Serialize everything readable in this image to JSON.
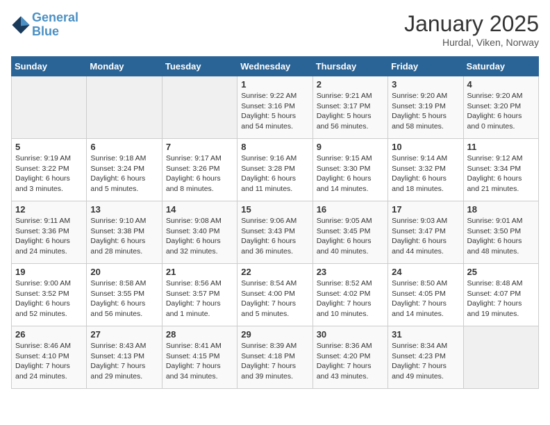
{
  "header": {
    "logo_line1": "General",
    "logo_line2": "Blue",
    "month_title": "January 2025",
    "location": "Hurdal, Viken, Norway"
  },
  "days_of_week": [
    "Sunday",
    "Monday",
    "Tuesday",
    "Wednesday",
    "Thursday",
    "Friday",
    "Saturday"
  ],
  "weeks": [
    [
      {
        "num": "",
        "info": ""
      },
      {
        "num": "",
        "info": ""
      },
      {
        "num": "",
        "info": ""
      },
      {
        "num": "1",
        "info": "Sunrise: 9:22 AM\nSunset: 3:16 PM\nDaylight: 5 hours\nand 54 minutes."
      },
      {
        "num": "2",
        "info": "Sunrise: 9:21 AM\nSunset: 3:17 PM\nDaylight: 5 hours\nand 56 minutes."
      },
      {
        "num": "3",
        "info": "Sunrise: 9:20 AM\nSunset: 3:19 PM\nDaylight: 5 hours\nand 58 minutes."
      },
      {
        "num": "4",
        "info": "Sunrise: 9:20 AM\nSunset: 3:20 PM\nDaylight: 6 hours\nand 0 minutes."
      }
    ],
    [
      {
        "num": "5",
        "info": "Sunrise: 9:19 AM\nSunset: 3:22 PM\nDaylight: 6 hours\nand 3 minutes."
      },
      {
        "num": "6",
        "info": "Sunrise: 9:18 AM\nSunset: 3:24 PM\nDaylight: 6 hours\nand 5 minutes."
      },
      {
        "num": "7",
        "info": "Sunrise: 9:17 AM\nSunset: 3:26 PM\nDaylight: 6 hours\nand 8 minutes."
      },
      {
        "num": "8",
        "info": "Sunrise: 9:16 AM\nSunset: 3:28 PM\nDaylight: 6 hours\nand 11 minutes."
      },
      {
        "num": "9",
        "info": "Sunrise: 9:15 AM\nSunset: 3:30 PM\nDaylight: 6 hours\nand 14 minutes."
      },
      {
        "num": "10",
        "info": "Sunrise: 9:14 AM\nSunset: 3:32 PM\nDaylight: 6 hours\nand 18 minutes."
      },
      {
        "num": "11",
        "info": "Sunrise: 9:12 AM\nSunset: 3:34 PM\nDaylight: 6 hours\nand 21 minutes."
      }
    ],
    [
      {
        "num": "12",
        "info": "Sunrise: 9:11 AM\nSunset: 3:36 PM\nDaylight: 6 hours\nand 24 minutes."
      },
      {
        "num": "13",
        "info": "Sunrise: 9:10 AM\nSunset: 3:38 PM\nDaylight: 6 hours\nand 28 minutes."
      },
      {
        "num": "14",
        "info": "Sunrise: 9:08 AM\nSunset: 3:40 PM\nDaylight: 6 hours\nand 32 minutes."
      },
      {
        "num": "15",
        "info": "Sunrise: 9:06 AM\nSunset: 3:43 PM\nDaylight: 6 hours\nand 36 minutes."
      },
      {
        "num": "16",
        "info": "Sunrise: 9:05 AM\nSunset: 3:45 PM\nDaylight: 6 hours\nand 40 minutes."
      },
      {
        "num": "17",
        "info": "Sunrise: 9:03 AM\nSunset: 3:47 PM\nDaylight: 6 hours\nand 44 minutes."
      },
      {
        "num": "18",
        "info": "Sunrise: 9:01 AM\nSunset: 3:50 PM\nDaylight: 6 hours\nand 48 minutes."
      }
    ],
    [
      {
        "num": "19",
        "info": "Sunrise: 9:00 AM\nSunset: 3:52 PM\nDaylight: 6 hours\nand 52 minutes."
      },
      {
        "num": "20",
        "info": "Sunrise: 8:58 AM\nSunset: 3:55 PM\nDaylight: 6 hours\nand 56 minutes."
      },
      {
        "num": "21",
        "info": "Sunrise: 8:56 AM\nSunset: 3:57 PM\nDaylight: 7 hours\nand 1 minute."
      },
      {
        "num": "22",
        "info": "Sunrise: 8:54 AM\nSunset: 4:00 PM\nDaylight: 7 hours\nand 5 minutes."
      },
      {
        "num": "23",
        "info": "Sunrise: 8:52 AM\nSunset: 4:02 PM\nDaylight: 7 hours\nand 10 minutes."
      },
      {
        "num": "24",
        "info": "Sunrise: 8:50 AM\nSunset: 4:05 PM\nDaylight: 7 hours\nand 14 minutes."
      },
      {
        "num": "25",
        "info": "Sunrise: 8:48 AM\nSunset: 4:07 PM\nDaylight: 7 hours\nand 19 minutes."
      }
    ],
    [
      {
        "num": "26",
        "info": "Sunrise: 8:46 AM\nSunset: 4:10 PM\nDaylight: 7 hours\nand 24 minutes."
      },
      {
        "num": "27",
        "info": "Sunrise: 8:43 AM\nSunset: 4:13 PM\nDaylight: 7 hours\nand 29 minutes."
      },
      {
        "num": "28",
        "info": "Sunrise: 8:41 AM\nSunset: 4:15 PM\nDaylight: 7 hours\nand 34 minutes."
      },
      {
        "num": "29",
        "info": "Sunrise: 8:39 AM\nSunset: 4:18 PM\nDaylight: 7 hours\nand 39 minutes."
      },
      {
        "num": "30",
        "info": "Sunrise: 8:36 AM\nSunset: 4:20 PM\nDaylight: 7 hours\nand 43 minutes."
      },
      {
        "num": "31",
        "info": "Sunrise: 8:34 AM\nSunset: 4:23 PM\nDaylight: 7 hours\nand 49 minutes."
      },
      {
        "num": "",
        "info": ""
      }
    ]
  ]
}
